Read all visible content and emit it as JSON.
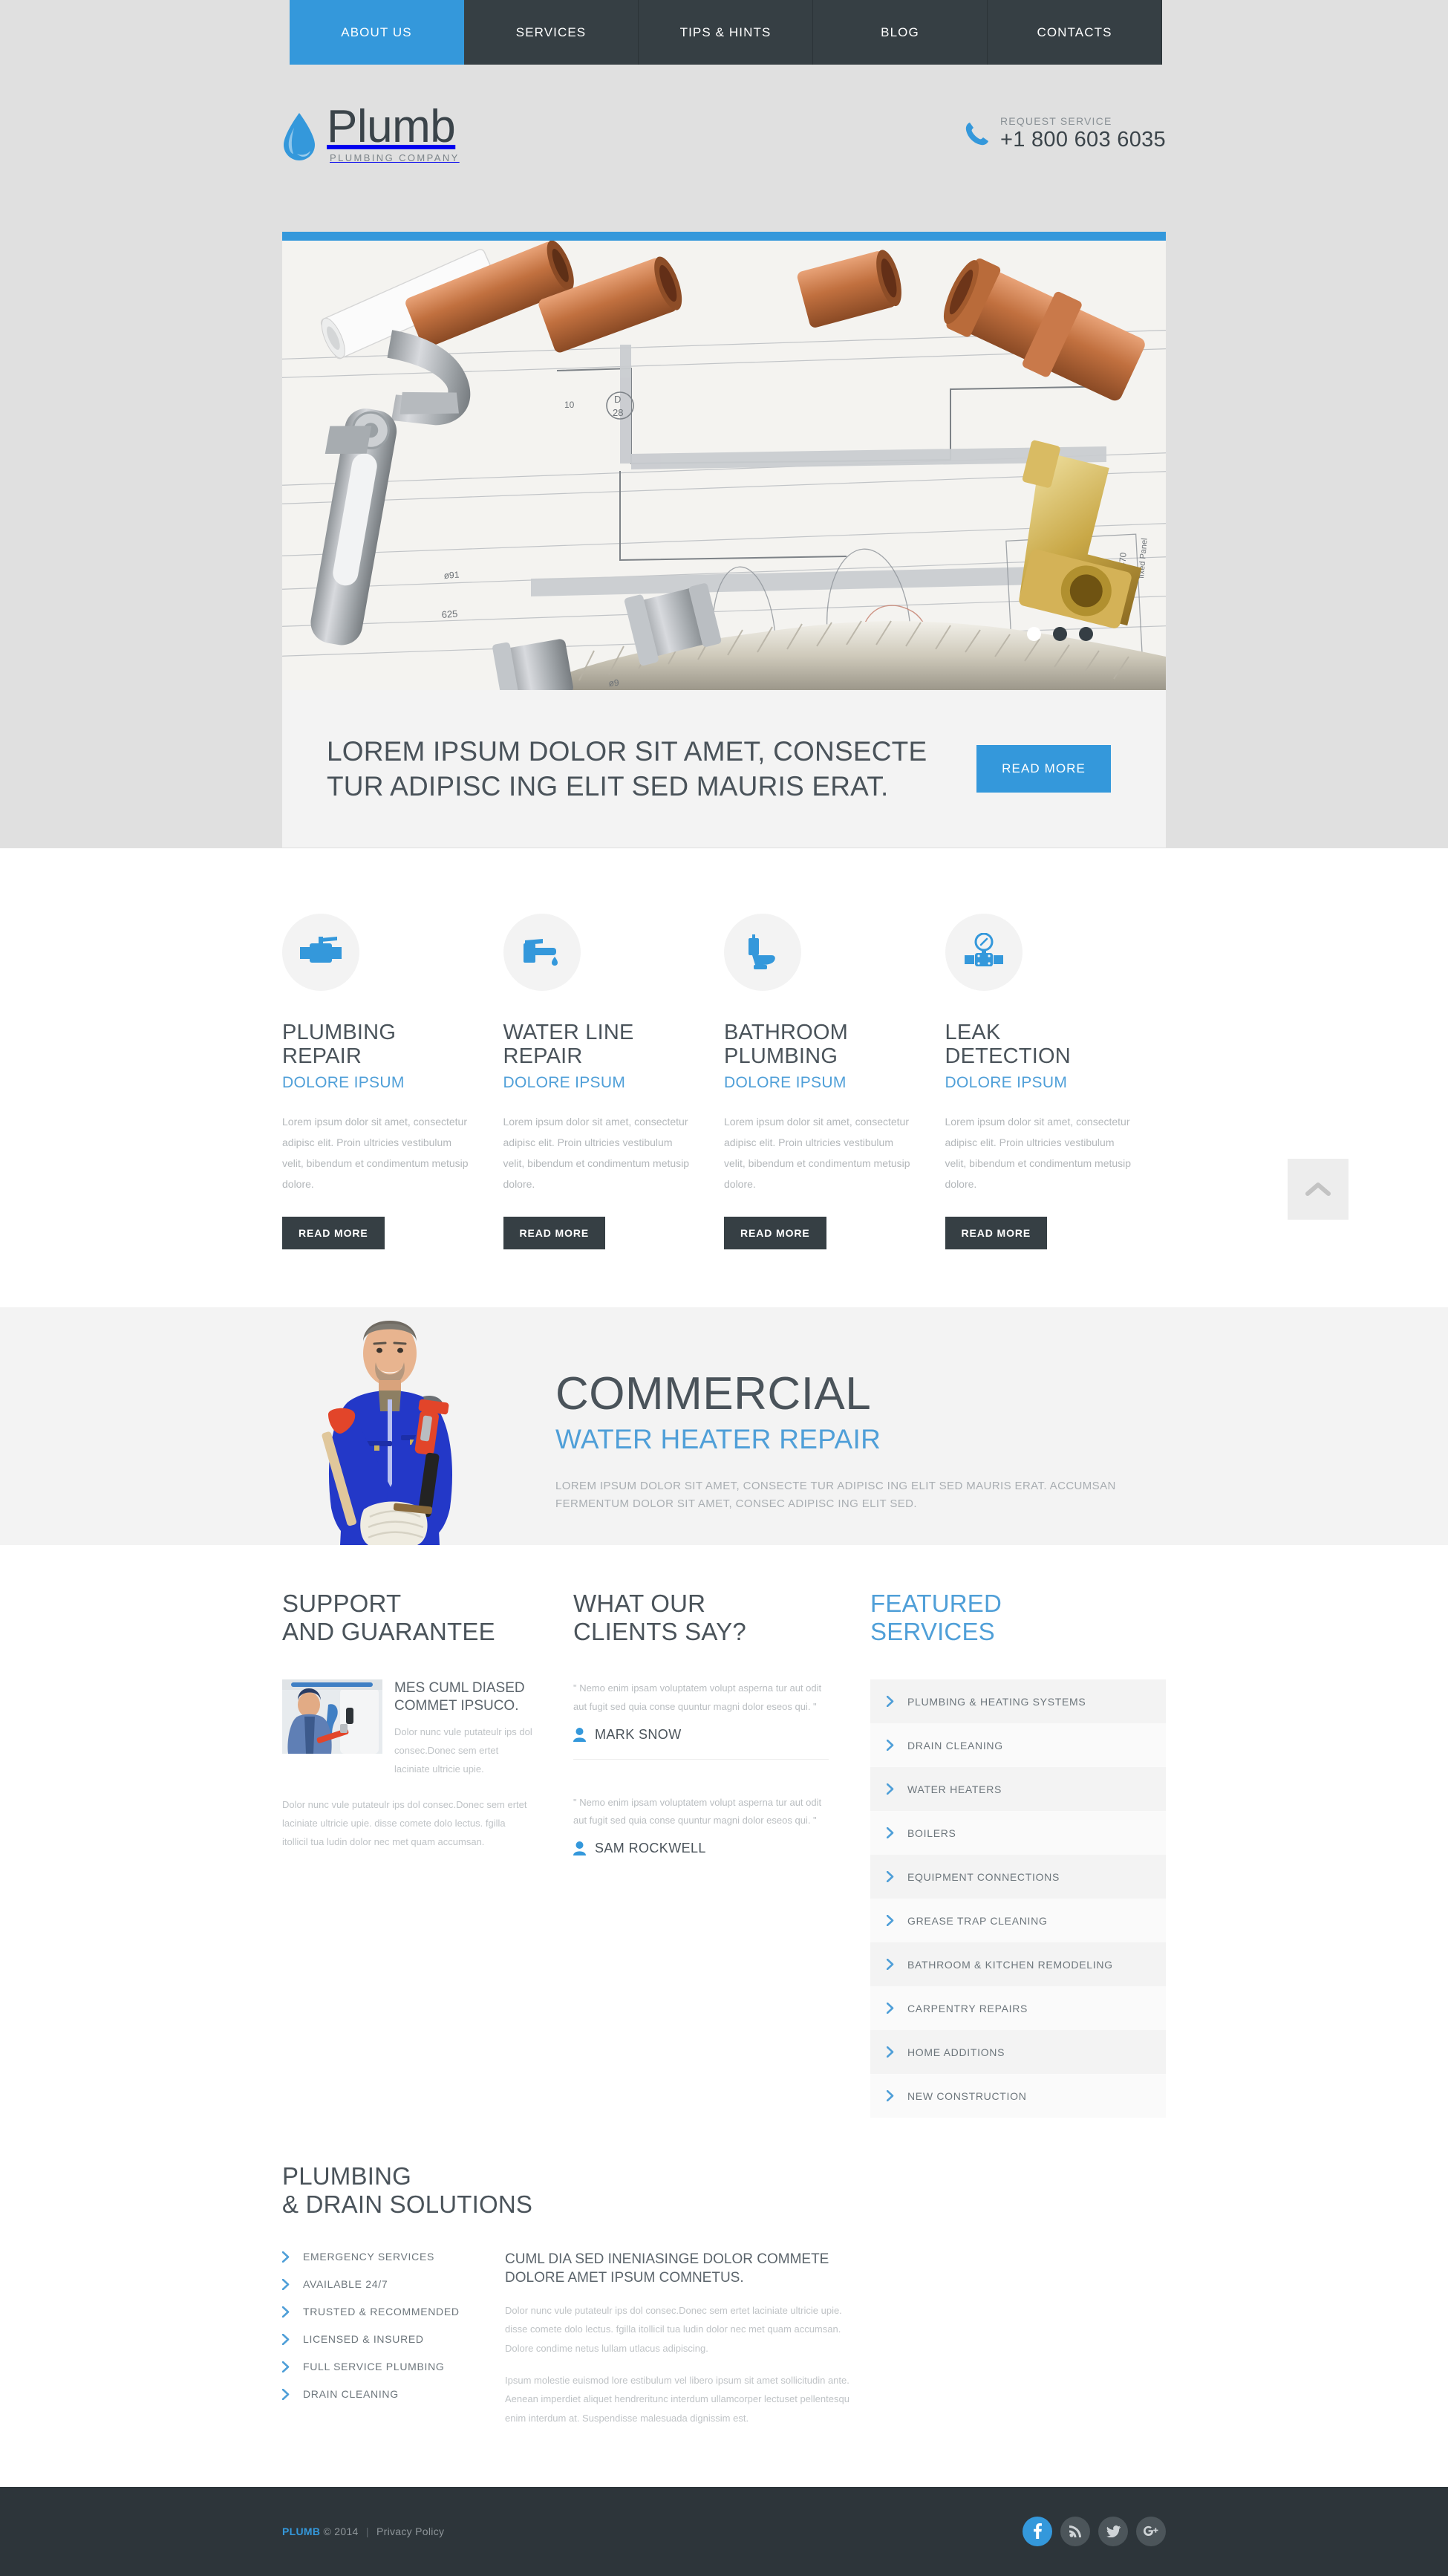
{
  "nav": {
    "items": [
      {
        "label": "ABOUT US",
        "active": true
      },
      {
        "label": "SERVICES",
        "active": false
      },
      {
        "label": "TIPS & HINTS",
        "active": false
      },
      {
        "label": "BLOG",
        "active": false
      },
      {
        "label": "CONTACTS",
        "active": false
      }
    ]
  },
  "header": {
    "logo_name": "Plumb",
    "logo_tagline": "PLUMBING COMPANY",
    "phone_label": "REQUEST SERVICE",
    "phone_number": "+1 800 603 6035"
  },
  "hero": {
    "caption": "LOREM IPSUM DOLOR SIT AMET, CONSECTE TUR ADIPISC ING ELIT SED MAURIS ERAT.",
    "button": "READ MORE",
    "slide_count": 3,
    "active_slide": 1,
    "accent_color": "#3498db"
  },
  "services": [
    {
      "icon": "valve-icon",
      "title": "PLUMBING REPAIR",
      "subtitle": "DOLORE IPSUM",
      "desc": "Lorem ipsum dolor sit amet, consectetur adipisc elit. Proin ultricies vestibulum velit, bibendum et condimentum metusip dolore.",
      "button": "READ MORE"
    },
    {
      "icon": "faucet-icon",
      "title": "WATER LINE REPAIR",
      "subtitle": "DOLORE IPSUM",
      "desc": "Lorem ipsum dolor sit amet, consectetur adipisc elit. Proin ultricies vestibulum velit, bibendum et condimentum metusip dolore.",
      "button": "READ MORE"
    },
    {
      "icon": "toilet-icon",
      "title": "BATHROOM PLUMBING",
      "subtitle": "DOLORE IPSUM",
      "desc": "Lorem ipsum dolor sit amet, consectetur adipisc elit. Proin ultricies vestibulum velit, bibendum et condimentum metusip dolore.",
      "button": "READ MORE"
    },
    {
      "icon": "pressure-gauge-icon",
      "title": "LEAK DETECTION",
      "subtitle": "DOLORE IPSUM",
      "desc": "Lorem ipsum dolor sit amet, consectetur adipisc elit. Proin ultricies vestibulum velit, bibendum et condimentum metusip dolore.",
      "button": "READ MORE"
    }
  ],
  "scroll_top_icon": "chevron-up-icon",
  "commercial": {
    "heading": "COMMERCIAL",
    "subheading": "WATER HEATER REPAIR",
    "paragraph": "LOREM IPSUM DOLOR SIT AMET, CONSECTE TUR ADIPISC ING ELIT SED MAURIS ERAT. ACCUMSAN FERMENTUM DOLOR SIT AMET, CONSEC ADIPISC ING ELIT SED."
  },
  "support": {
    "heading_line1": "SUPPORT",
    "heading_line2": "AND GUARANTEE",
    "sub_heading": "MES CUML DIASED COMMET IPSUCO.",
    "text_right": "Dolor nunc vule putateulr ips dol consec.Donec sem ertet laciniate ultricie upie.",
    "text_below": "Dolor nunc vule putateulr ips dol consec.Donec sem ertet laciniate ultricie upie. disse comete dolo lectus. fgilla itollicil tua ludin dolor nec met quam accumsan."
  },
  "testimonials": {
    "heading_line1": "WHAT OUR",
    "heading_line2": "CLIENTS SAY?",
    "items": [
      {
        "quote": "\" Nemo enim ipsam voluptatem volupt asperna tur aut odit aut fugit sed quia conse quuntur magni dolor eseos qui. \"",
        "author": "MARK SNOW",
        "icon": "user-icon"
      },
      {
        "quote": "\" Nemo enim ipsam voluptatem volupt asperna tur aut odit aut fugit sed quia conse quuntur magni dolor eseos qui. \"",
        "author": "SAM ROCKWELL",
        "icon": "user-icon"
      }
    ]
  },
  "featured": {
    "heading_line1": "FEATURED",
    "heading_line2": "SERVICES",
    "items": [
      "PLUMBING & HEATING SYSTEMS",
      "DRAIN CLEANING",
      "WATER HEATERS",
      "BOILERS",
      "EQUIPMENT CONNECTIONS",
      "GREASE TRAP CLEANING",
      "BATHROOM & KITCHEN REMODELING",
      "CARPENTRY REPAIRS",
      "HOME ADDITIONS",
      "NEW CONSTRUCTION"
    ]
  },
  "solutions": {
    "heading_line1": "PLUMBING",
    "heading_line2": "& DRAIN SOLUTIONS",
    "list": [
      "EMERGENCY SERVICES",
      "AVAILABLE 24/7",
      "TRUSTED & RECOMMENDED",
      "LICENSED & INSURED",
      "FULL SERVICE PLUMBING",
      "DRAIN CLEANING"
    ],
    "right_heading": "CUML DIA SED INENIASINGE DOLOR COMMETE DOLORE AMET IPSUM COMNETUS.",
    "right_p1": "Dolor nunc vule putateulr ips dol consec.Donec sem ertet laciniate ultricie upie. disse comete dolo lectus. fgilla itollicil tua ludin dolor nec met quam accumsan. Dolore condime netus lullam utlacus adipiscing.",
    "right_p2": "Ipsum molestie euismod lore estibulum vel libero ipsum sit amet sollicitudin ante. Aenean imperdiet aliquet hendreritunc interdum ullamcorper lectuset pellentesqu enim interdum at. Suspendisse malesuada dignissim est."
  },
  "footer": {
    "brand": "PLUMB",
    "copyright": "© 2014",
    "separator": "|",
    "privacy": "Privacy Policy",
    "socials": [
      {
        "name": "facebook-icon",
        "glyph": "f"
      },
      {
        "name": "rss-icon",
        "glyph": "◠"
      },
      {
        "name": "twitter-icon",
        "glyph": "ᴠ"
      },
      {
        "name": "google-plus-icon",
        "glyph": "g"
      }
    ]
  }
}
